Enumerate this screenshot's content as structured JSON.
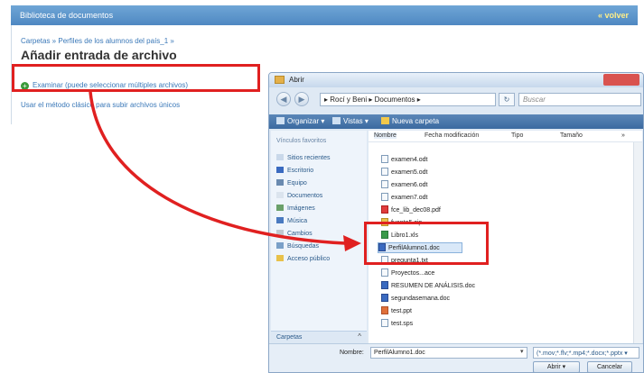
{
  "web": {
    "header_title": "Biblioteca de documentos",
    "back_label": "« volver",
    "breadcrumb": "Carpetas » Perfiles de los alumnos del país_1 »",
    "page_title": "Añadir entrada de archivo",
    "examine_label": "Examinar (puede seleccionar múltiples archivos)",
    "classic_label": "Usar el método clásico para subir archivos únicos"
  },
  "dialog": {
    "title": "Abrir",
    "address": "▸ Rocí y Beni ▸ Documentos ▸",
    "search_placeholder": "Buscar",
    "toolbar": {
      "organize": "Organizar ▾",
      "views": "Vistas ▾",
      "new_folder": "Nueva carpeta"
    },
    "nav": {
      "title": "Vínculos favoritos",
      "items": [
        "Sitios recientes",
        "Escritorio",
        "Equipo",
        "Documentos",
        "Imágenes",
        "Música",
        "Cambios",
        "Búsquedas",
        "Acceso público"
      ],
      "folders_label": "Carpetas"
    },
    "columns": [
      "Nombre",
      "Fecha modificación",
      "Tipo",
      "Tamaño",
      "»"
    ],
    "files": [
      "examen4.odt",
      "examen5.odt",
      "examen6.odt",
      "examen7.odt",
      "fce_lib_dec08.pdf",
      "fuente5.zip",
      "Libro1.xls",
      "PerfilAlumno1.doc",
      "pregunta1.txt",
      "Proyectos...ace",
      "RESUMEN DE ANÁLISIS.doc",
      "segundasemana.doc",
      "test.ppt",
      "test.sps"
    ],
    "filename_label": "Nombre:",
    "filename_value": "PerfilAlumno1.doc",
    "filter_value": "(*.mov;*.flv;*.mp4;*.docx;*.pptx ▾",
    "open_button": "Abrir",
    "cancel_button": "Cancelar"
  },
  "colors": {
    "annotation_red": "#e02020",
    "header_blue": "#5b92c8",
    "link_blue": "#3a78b8"
  }
}
